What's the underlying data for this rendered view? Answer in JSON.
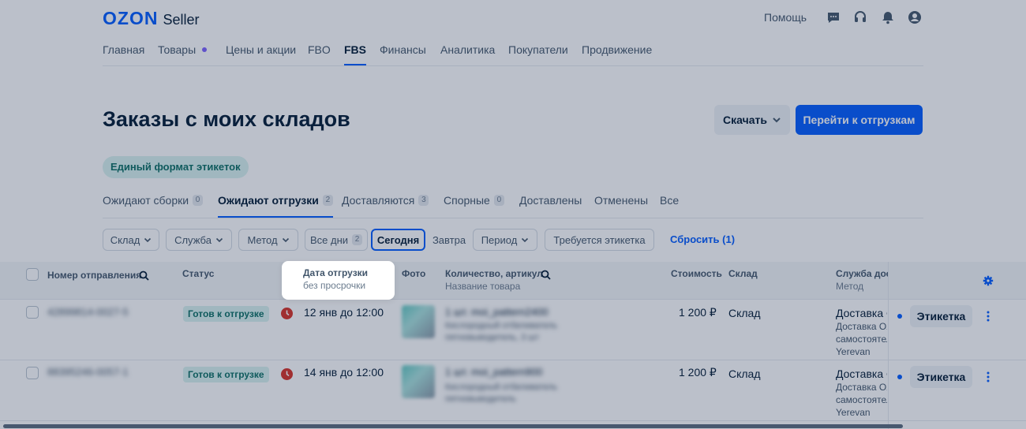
{
  "brand": {
    "logo_main": "OZON",
    "logo_sub": "Seller",
    "accent": "#005bff"
  },
  "header": {
    "help": "Помощь",
    "icons": [
      "chat-icon",
      "headset-icon",
      "bell-icon",
      "profile-icon"
    ]
  },
  "mainnav": {
    "items": [
      {
        "label": "Главная"
      },
      {
        "label": "Товары"
      },
      {
        "label": "Цены и акции"
      },
      {
        "label": "FBO"
      },
      {
        "label": "FBS"
      },
      {
        "label": "Финансы"
      },
      {
        "label": "Аналитика"
      },
      {
        "label": "Покупатели"
      },
      {
        "label": "Продвижение"
      }
    ],
    "active": "FBS"
  },
  "page": {
    "title": "Заказы с моих складов",
    "download": "Скачать",
    "go_shipments": "Перейти к отгрузкам",
    "label_format": "Единый формат этикеток"
  },
  "status_tabs": [
    {
      "label": "Ожидают сборки",
      "count": "0"
    },
    {
      "label": "Ожидают отгрузки",
      "count": "2"
    },
    {
      "label": "Доставляются",
      "count": "3"
    },
    {
      "label": "Спорные",
      "count": "0"
    },
    {
      "label": "Доставлены"
    },
    {
      "label": "Отменены"
    },
    {
      "label": "Все"
    }
  ],
  "filters": {
    "warehouse": "Склад",
    "service": "Служба",
    "method": "Метод",
    "all_days": "Все дни",
    "all_days_count": "2",
    "today": "Сегодня",
    "tomorrow": "Завтра",
    "period": "Период",
    "needs_label": "Требуется этикетка",
    "reset": "Сбросить (1)"
  },
  "table": {
    "columns": {
      "number": "Номер отправления",
      "status": "Статус",
      "date": "Дата отгрузки",
      "date_sub": "без просрочки",
      "photo": "Фото",
      "qty": "Количество, артикул",
      "qty_sub": "Название товара",
      "cost": "Стоимость",
      "warehouse": "Склад",
      "service": "Служба доставки",
      "service_sub": "Метод"
    },
    "rows": [
      {
        "number": "42899814-0027-5",
        "status": "Готов к отгрузке",
        "date": "12 янв до 12:00",
        "qty_line": "1 шт. moi_pattern2400",
        "product_line1": "Кислородный отбеливатель",
        "product_line2": "пятновыводитель, 3 шт",
        "price": "1 200 ₽",
        "warehouse": "Склад",
        "delivery_title": "Доставка Ozon",
        "delivery_sub1": "Доставка Ozon",
        "delivery_sub2": "самостоятельно",
        "delivery_sub3": "Yerevan",
        "label_btn": "Этикетка"
      },
      {
        "number": "88395246-0057-1",
        "status": "Готов к отгрузке",
        "date": "14 янв до 12:00",
        "qty_line": "1 шт. moi_pattern900",
        "product_line1": "Кислородный отбеливатель",
        "product_line2": "пятновыводитель",
        "price": "1 200 ₽",
        "warehouse": "Склад",
        "delivery_title": "Доставка Ozon",
        "delivery_sub1": "Доставка Ozon",
        "delivery_sub2": "самостоятельно",
        "delivery_sub3": "Yerevan",
        "label_btn": "Этикетка"
      }
    ]
  }
}
